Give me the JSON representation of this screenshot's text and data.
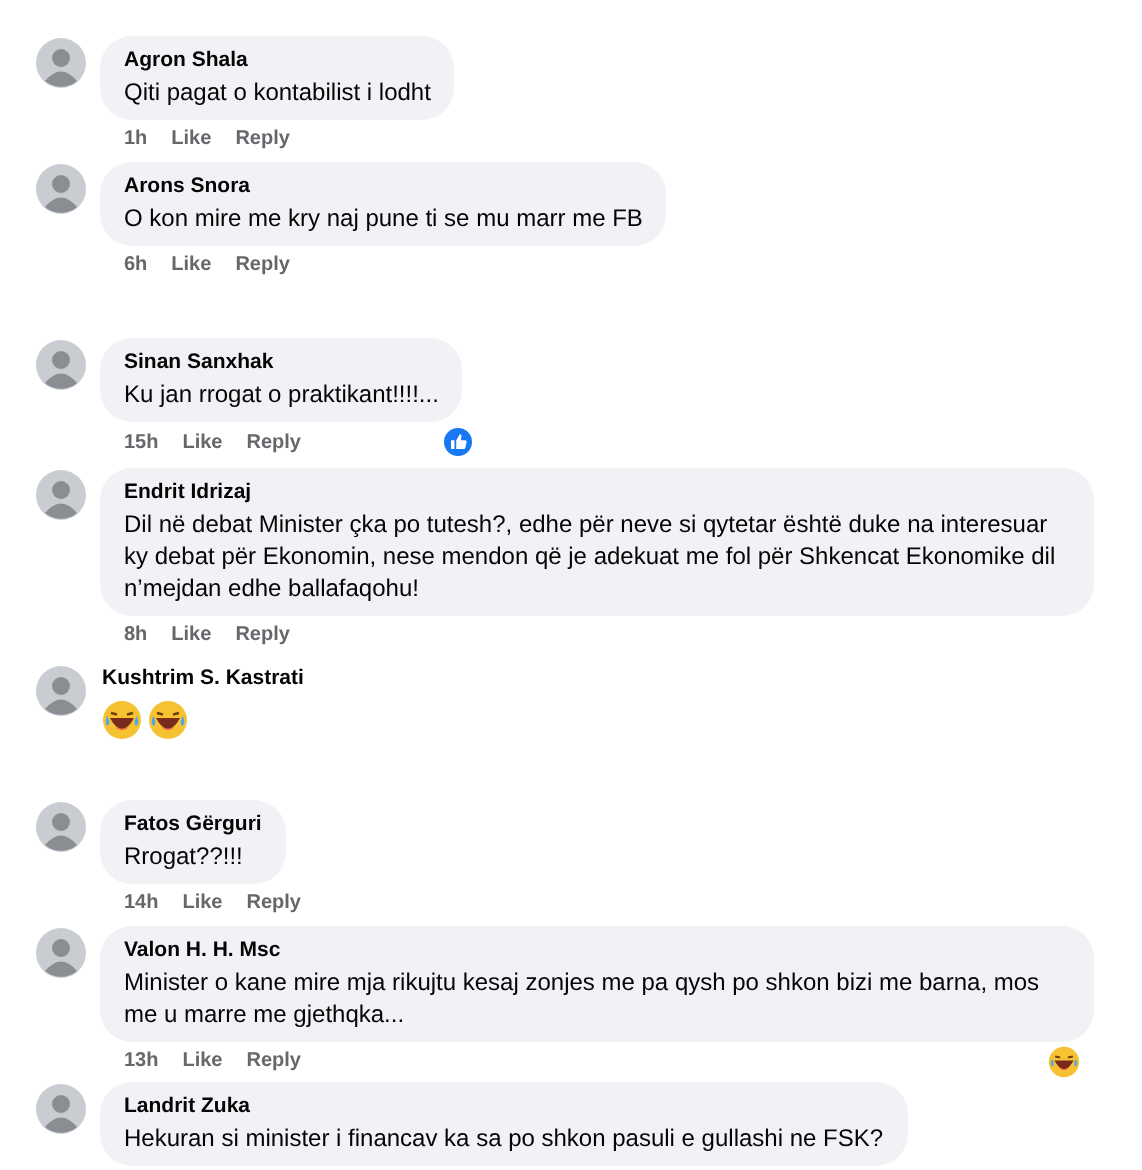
{
  "comments": [
    {
      "kind": "text",
      "author": "Agron Shala",
      "text": "Qiti pagat o kontabilist i lodht",
      "time": "1h",
      "like": "Like",
      "reply": "Reply"
    },
    {
      "kind": "text",
      "author": "Arons Snora",
      "text": "O kon mire me kry naj pune ti se mu marr me FB",
      "time": "6h",
      "like": "Like",
      "reply": "Reply"
    },
    {
      "kind": "text",
      "author": "Sinan Sanxhak",
      "text": "Ku jan rrogat o praktikant!!!!...",
      "time": "15h",
      "like": "Like",
      "reply": "Reply",
      "reaction": {
        "kind": "like"
      }
    },
    {
      "kind": "text",
      "author": "Endrit Idrizaj",
      "text": "Dil në debat Minister çka po tutesh?, edhe për neve si qytetar është duke na interesuar ky debat për Ekonomin, nese mendon që je adekuat me fol për Shkencat Ekonomike dil n’mejdan edhe ballafaqohu!",
      "time": "8h",
      "like": "Like",
      "reply": "Reply"
    },
    {
      "kind": "emoji",
      "author": "Kushtrim S. Kastrati",
      "emojis": [
        {
          "kind": "laughing"
        },
        {
          "kind": "laughing"
        }
      ]
    },
    {
      "kind": "text",
      "author": "Fatos Gërguri",
      "text": "Rrogat??!!!",
      "time": "14h",
      "like": "Like",
      "reply": "Reply"
    },
    {
      "kind": "text",
      "author": "Valon H. H. Msc",
      "text": "Minister o kane mire mja rikujtu kesaj zonjes me pa qysh po shkon bizi me barna, mos me u marre me gjethqka...",
      "time": "13h",
      "like": "Like",
      "reply": "Reply",
      "reaction": {
        "kind": "haha"
      }
    },
    {
      "kind": "text",
      "author": "Landrit Zuka",
      "text": "Hekuran si minister i financav ka sa po shkon pasuli e gullashi ne FSK?"
    }
  ]
}
